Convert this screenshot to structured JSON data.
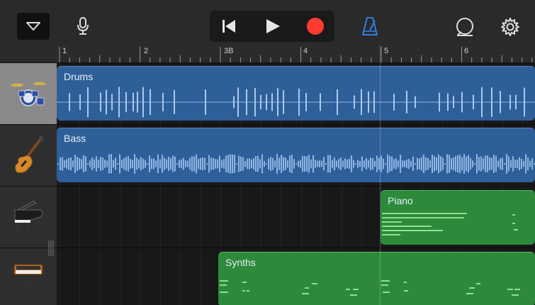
{
  "toolbar": {
    "track_view_icon": "triangle-down-icon",
    "mic_icon": "microphone-icon",
    "rewind_icon": "skip-back-icon",
    "play_icon": "play-icon",
    "record_icon": "record-icon",
    "metronome_icon": "metronome-icon",
    "loop_icon": "loop-browser-icon",
    "settings_icon": "gear-icon"
  },
  "ruler": {
    "labels": [
      "1",
      "2",
      "3B",
      "4",
      "5",
      "6"
    ]
  },
  "tracks": [
    {
      "instrument_icon": "drum-kit-icon"
    },
    {
      "instrument_icon": "bass-guitar-icon"
    },
    {
      "instrument_icon": "grand-piano-icon"
    },
    {
      "instrument_icon": "synth-keyboard-icon"
    }
  ],
  "regions": [
    {
      "name": "Drums"
    },
    {
      "name": "Bass"
    },
    {
      "name": "Piano"
    },
    {
      "name": "Synths"
    }
  ],
  "colors": {
    "audio_region": "#2f5f99",
    "midi_region": "#2c8a3a",
    "record": "#ff3b30",
    "metronome": "#2f7fe0"
  }
}
